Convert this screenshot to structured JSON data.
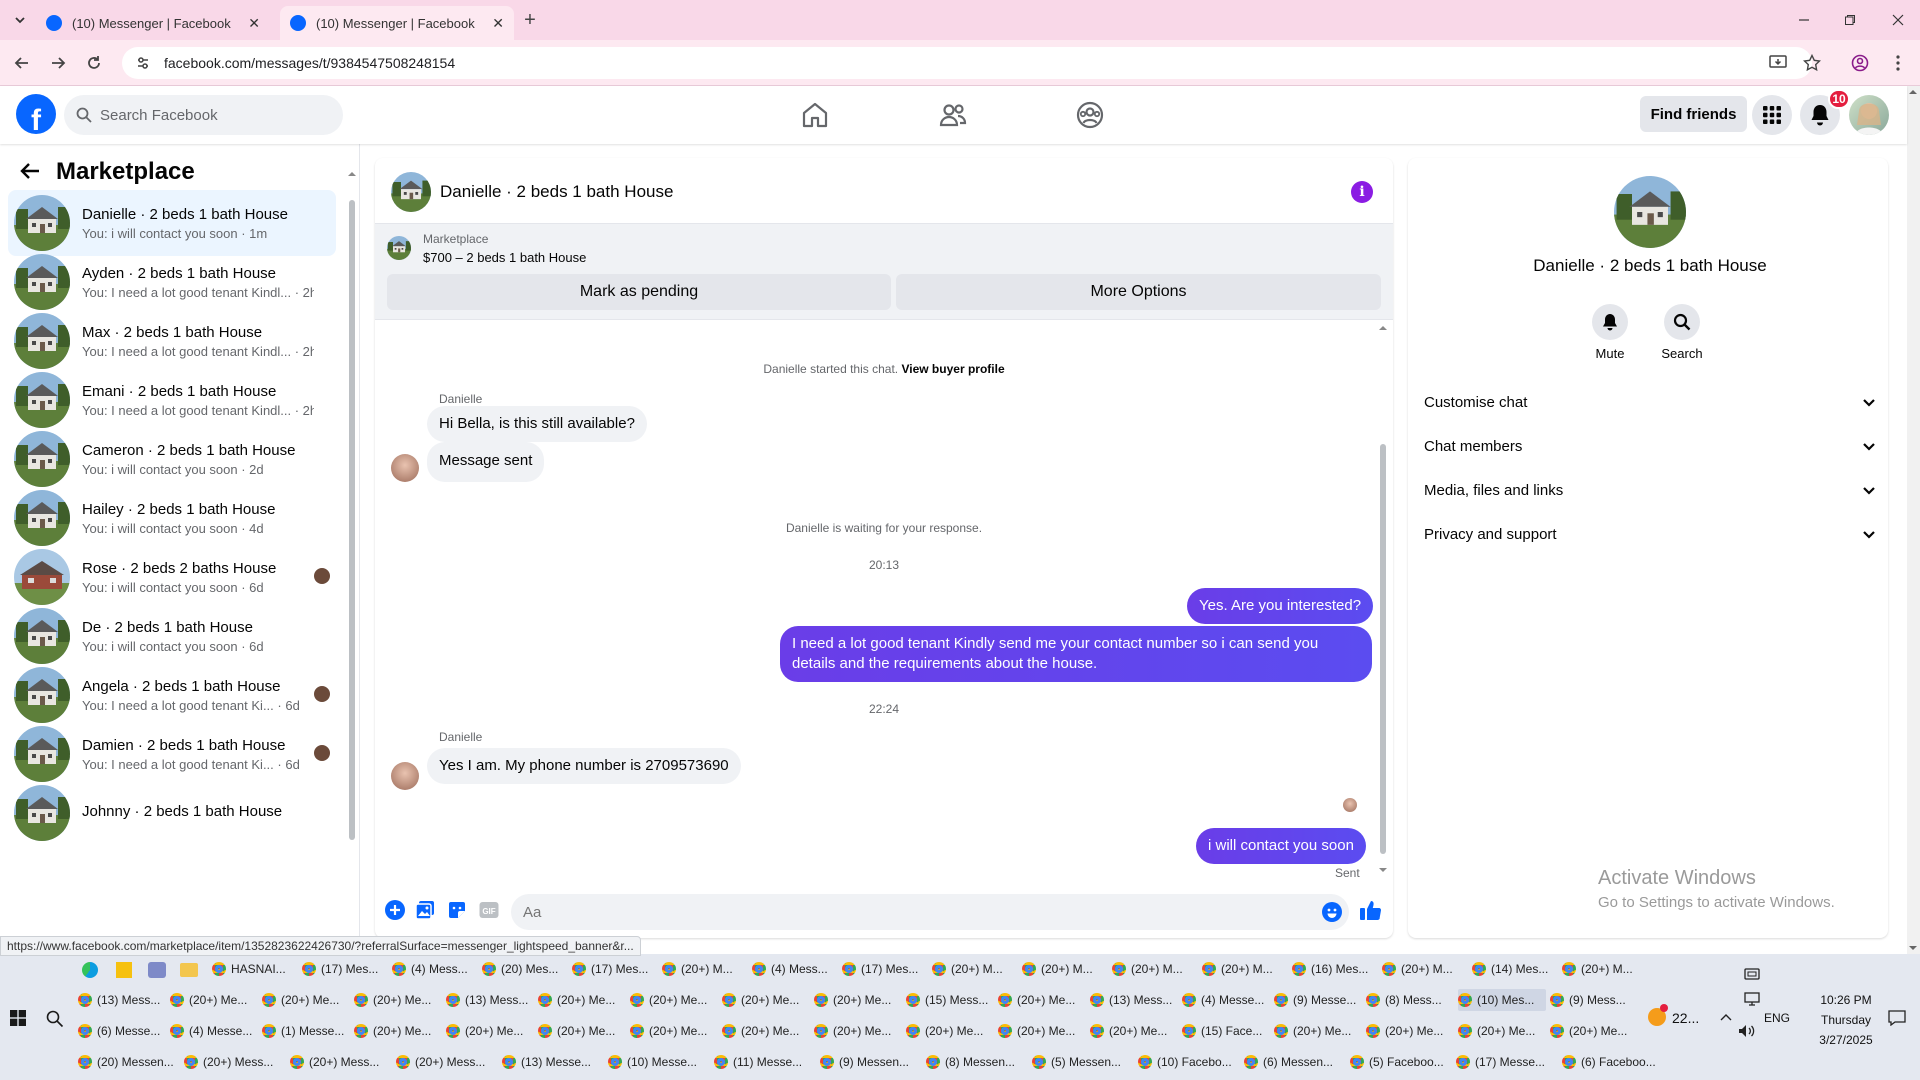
{
  "browser": {
    "tabs": [
      {
        "title": "(10) Messenger | Facebook",
        "active": false
      },
      {
        "title": "(10) Messenger | Facebook",
        "active": true
      }
    ],
    "url": "facebook.com/messages/t/9384547508248154",
    "status_url": "https://www.facebook.com/marketplace/item/1352823622426730/?referralSurface=messenger_lightspeed_banner&r..."
  },
  "header": {
    "logo": "f",
    "search_placeholder": "Search Facebook",
    "find_friends": "Find friends",
    "notification_count": "10"
  },
  "sidebar": {
    "title": "Marketplace",
    "conversations": [
      {
        "name": "Danielle · 2 beds 1 bath House",
        "snippet": "You: i will contact you soon · 1m",
        "active": true
      },
      {
        "name": "Ayden · 2 beds 1 bath House",
        "snippet": "You: I need a lot good tenant Kindl... · 2h"
      },
      {
        "name": "Max · 2 beds 1 bath House",
        "snippet": "You: I need a lot good tenant Kindl... · 2h"
      },
      {
        "name": "Emani · 2 beds 1 bath House",
        "snippet": "You: I need a lot good tenant Kindl... · 2h"
      },
      {
        "name": "Cameron · 2 beds 1 bath House",
        "snippet": "You: i will contact you soon · 2d"
      },
      {
        "name": "Hailey · 2 beds 1 bath House",
        "snippet": "You: i will contact you soon · 4d"
      },
      {
        "name": "Rose · 2 beds 2 baths House",
        "snippet": "You: i will contact you soon · 6d",
        "mini": true
      },
      {
        "name": "De · 2 beds 1 bath House",
        "snippet": "You: i will contact you soon · 6d"
      },
      {
        "name": "Angela · 2 beds 1 bath House",
        "snippet": "You: I need a lot good tenant Ki... · 6d",
        "mini": true
      },
      {
        "name": "Damien · 2 beds 1 bath House",
        "snippet": "You: I need a lot good tenant Ki... · 6d",
        "mini": true
      },
      {
        "name": "Johnny · 2 beds 1 bath House",
        "snippet": ""
      }
    ]
  },
  "chat": {
    "title": "Danielle · 2 beds 1 bath House",
    "marketplace_label": "Marketplace",
    "listing": "$700 – 2 beds 1 bath House",
    "mark_pending": "Mark as pending",
    "more_options": "More Options",
    "started_text": "Danielle started this chat.",
    "view_buyer": "View buyer profile",
    "sender": "Danielle",
    "msg1": "Hi Bella, is this still available?",
    "msg2": "Message sent",
    "waiting": "Danielle is waiting for your response.",
    "time1": "20:13",
    "out1": "Yes. Are you interested?",
    "out2": "I need a lot good tenant Kindly send me your contact number so i can send you details and the requirements about the house.",
    "time2": "22:24",
    "msg3": "Yes I am. My phone number is 2709573690",
    "out3": "i will contact you soon",
    "sent": "Sent",
    "input_placeholder": "Aa"
  },
  "details": {
    "name": "Danielle · 2 beds 1 bath House",
    "mute": "Mute",
    "search": "Search",
    "sections": [
      "Customise chat",
      "Chat members",
      "Media, files and links",
      "Privacy and support"
    ],
    "activate_title": "Activate Windows",
    "activate_sub": "Go to Settings to activate Windows."
  },
  "taskbar": {
    "rows": [
      [
        "HASNAI...",
        "(17) Mes...",
        "(4) Mess...",
        "(20) Mes...",
        "(17) Mes...",
        "(20+) M...",
        "(4) Mess...",
        "(17) Mes...",
        "(20+) M...",
        "(20+) M...",
        "(20+) M...",
        "(20+) M...",
        "(16) Mes...",
        "(20+) M...",
        "(14) Mes...",
        "(20+) M..."
      ],
      [
        "(13) Mess...",
        "(20+) Me...",
        "(20+) Me...",
        "(20+) Me...",
        "(13) Mess...",
        "(20+) Me...",
        "(20+) Me...",
        "(20+) Me...",
        "(20+) Me...",
        "(15) Mess...",
        "(20+) Me...",
        "(13) Mess...",
        "(4) Messe...",
        "(9) Messe...",
        "(8) Mess...",
        "(10) Mes...",
        "(9) Mess..."
      ],
      [
        "(6) Messe...",
        "(4) Messe...",
        "(1) Messe...",
        "(20+) Me...",
        "(20+) Me...",
        "(20+) Me...",
        "(20+) Me...",
        "(20+) Me...",
        "(20+) Me...",
        "(20+) Me...",
        "(20+) Me...",
        "(20+) Me...",
        "(15) Face...",
        "(20+) Me...",
        "(20+) Me...",
        "(20+) Me...",
        "(20+) Me..."
      ],
      [
        "(20) Messen...",
        "(20+) Mess...",
        "(20+) Mess...",
        "(20+) Mess...",
        "(13) Messe...",
        "(10) Messe...",
        "(11) Messe...",
        "(9) Messen...",
        "(8) Messen...",
        "(5) Messen...",
        "(10) Facebo...",
        "(6) Messen...",
        "(5) Faceboo...",
        "(17) Messe...",
        "(6) Faceboo..."
      ]
    ],
    "weather": "22...",
    "lang": "ENG",
    "time": "10:26 PM",
    "day": "Thursday",
    "date": "3/27/2025"
  }
}
